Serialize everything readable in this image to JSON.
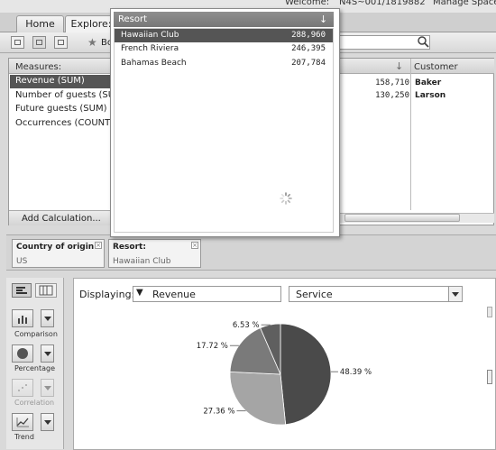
{
  "header": {
    "welcome": "Welcome:",
    "username": "N4S~001/1819882",
    "manage": "Manage Space"
  },
  "tabs": [
    {
      "label": "Home"
    },
    {
      "label": "Explore:"
    }
  ],
  "toolbar": {
    "bookmark_label": "Bo"
  },
  "measures": {
    "title": "Measures:",
    "items": [
      "Revenue (SUM)",
      "Number of guests (SUM)",
      "Future guests (SUM)",
      "Occurrences (COUNT)"
    ],
    "add_calc": "Add Calculation..."
  },
  "table": {
    "customer_header": "Customer",
    "rows": [
      {
        "value": "158,710",
        "customer": "Baker"
      },
      {
        "value": "130,250",
        "customer": "Larson"
      }
    ]
  },
  "resort_popup": {
    "title": "Resort",
    "rows": [
      {
        "name": "Hawaiian Club",
        "value": "288,960"
      },
      {
        "name": "French Riviera",
        "value": "246,395"
      },
      {
        "name": "Bahamas Beach",
        "value": "207,784"
      }
    ]
  },
  "filters": [
    {
      "title": "Country of origin:",
      "value": "US"
    },
    {
      "title": "Resort:",
      "value": "Hawaiian Club"
    }
  ],
  "chart_types": {
    "comparison": "Comparison",
    "percentage": "Percentage",
    "correlation": "Correlation",
    "trend": "Trend"
  },
  "chart_controls": {
    "displaying_label": "Displaying:",
    "measure_value": "Revenue",
    "dimension_value": "Service"
  },
  "chart_data": {
    "type": "pie",
    "slices": [
      {
        "label": "48.39 %",
        "value": 48.39,
        "color": "#4a4a4a"
      },
      {
        "label": "27.36 %",
        "value": 27.36,
        "color": "#a5a5a5"
      },
      {
        "label": "17.72 %",
        "value": 17.72,
        "color": "#7a7a7a"
      },
      {
        "label": "6.53 %",
        "value": 6.53,
        "color": "#5f5f5f"
      }
    ]
  }
}
